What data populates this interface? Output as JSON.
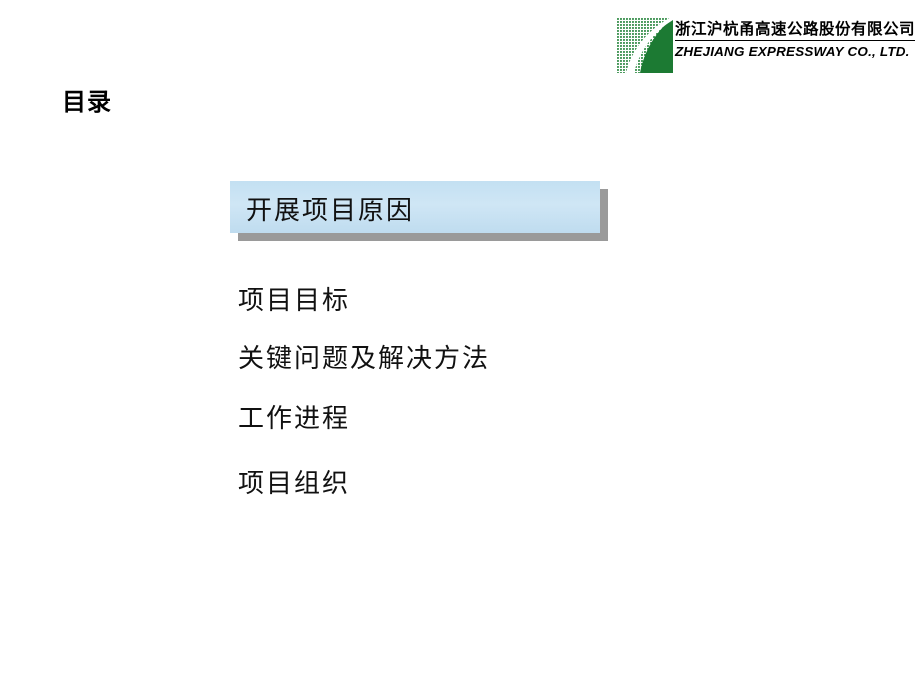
{
  "slide": {
    "title": "目录",
    "background_color": "#ffffff"
  },
  "logo": {
    "mark_name": "zhejiang-expressway-logo",
    "company_cn": "浙江沪杭甬高速公路股份有限公司",
    "company_en": "ZHEJIANG EXPRESSWAY CO., LTD.",
    "green_dark": "#1c7a33",
    "green_light": "#8cc08c"
  },
  "toc": {
    "items": [
      {
        "label": "开展项目原因",
        "highlighted": true
      },
      {
        "label": "项目目标",
        "highlighted": false
      },
      {
        "label": "关键问题及解决方法",
        "highlighted": false
      },
      {
        "label": "工作进程",
        "highlighted": false
      },
      {
        "label": "项目组织",
        "highlighted": false
      }
    ],
    "highlight_fill": "#cbe4f4",
    "highlight_shadow": "#9a9a9a",
    "text_color": "#111111"
  }
}
